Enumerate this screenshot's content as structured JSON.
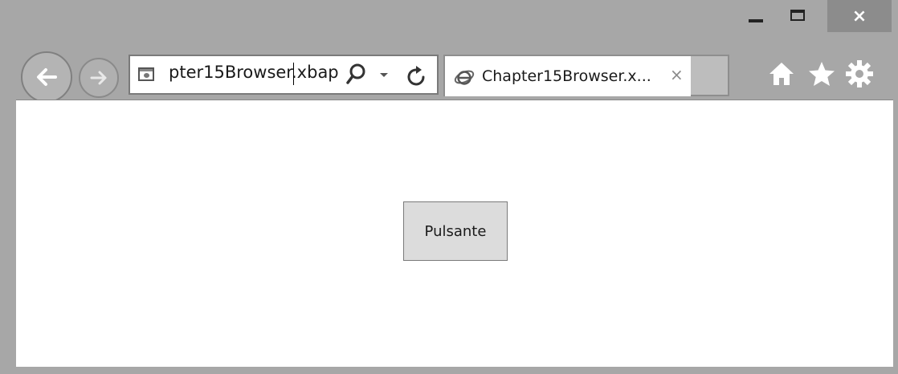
{
  "window": {
    "close_label": "×"
  },
  "address": {
    "url_text": "pter15Browser.xbap"
  },
  "tab": {
    "title": "Chapter15Browser.x...",
    "close_label": "×"
  },
  "content": {
    "button_label": "Pulsante"
  },
  "icons": {
    "back": "back-arrow-icon",
    "forward": "forward-arrow-icon",
    "page": "page-icon",
    "search": "search-icon",
    "dropdown": "chevron-down-icon",
    "refresh": "refresh-icon",
    "ie": "ie-icon",
    "home": "home-icon",
    "favorites": "star-icon",
    "tools": "gear-icon"
  }
}
